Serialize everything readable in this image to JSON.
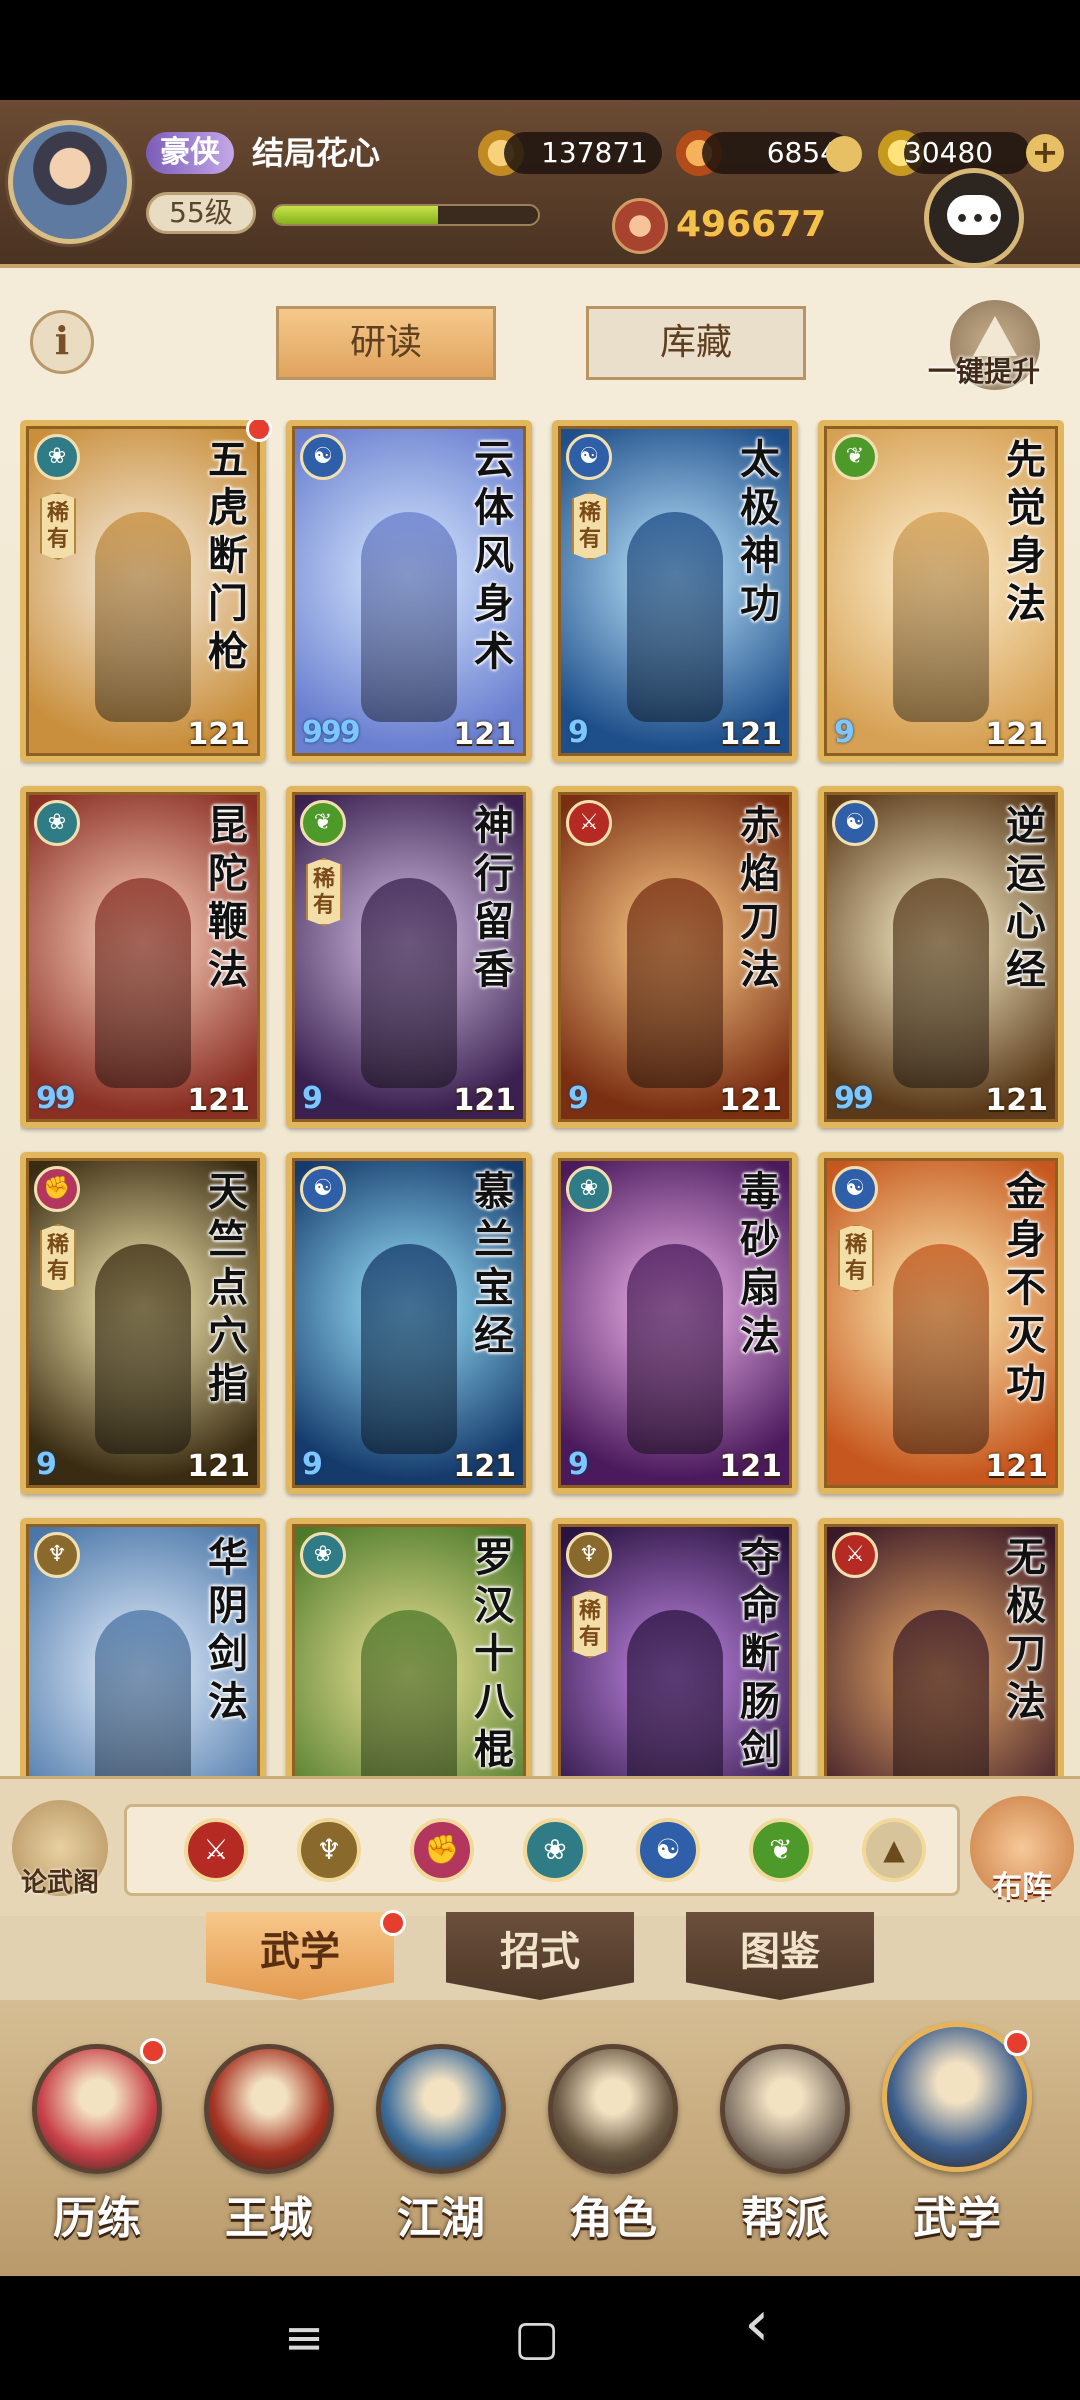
{
  "header": {
    "rank_badge": "豪侠",
    "player_name": "结局花心",
    "level": "55级",
    "exp_fraction": 0.62,
    "copper": "137871",
    "jade": "6854",
    "gold": "30480",
    "power": "496677",
    "icons": {
      "avatar": "avatar",
      "copper": "copper-coin-icon",
      "jade": "spirit-jade-icon",
      "gold": "gold-ingot-icon",
      "add": "plus-icon",
      "chat": "chat-icon",
      "power": "combat-power-icon"
    }
  },
  "top_tabs": {
    "info": "i",
    "study": "研读",
    "library": "库藏",
    "upgrade": "一键提升"
  },
  "cards": [
    {
      "title": "五虎断门枪",
      "level": "121",
      "rare": "稀有",
      "pips": "",
      "school": "lotus",
      "notify": true,
      "bg": [
        "#f7efe2",
        "#c98f3d"
      ]
    },
    {
      "title": "云体风身术",
      "level": "121",
      "rare": "",
      "pips": "999",
      "school": "taiji",
      "notify": false,
      "bg": [
        "#d9ebff",
        "#6a7fd0"
      ]
    },
    {
      "title": "太极神功",
      "level": "121",
      "rare": "稀有",
      "pips": "9",
      "school": "taiji",
      "notify": false,
      "bg": [
        "#bfe8ff",
        "#1f4f8a"
      ]
    },
    {
      "title": "先觉身法",
      "level": "121",
      "rare": "",
      "pips": "9",
      "school": "leaf",
      "notify": false,
      "bg": [
        "#fff1d2",
        "#d6a154"
      ]
    },
    {
      "title": "昆陀鞭法",
      "level": "121",
      "rare": "",
      "pips": "99",
      "school": "lotus",
      "notify": false,
      "bg": [
        "#ffd7c2",
        "#8a2f24"
      ]
    },
    {
      "title": "神行留香",
      "level": "121",
      "rare": "稀有",
      "pips": "9",
      "school": "leaf",
      "notify": false,
      "bg": [
        "#d7c3e8",
        "#3b2150"
      ]
    },
    {
      "title": "赤焰刀法",
      "level": "121",
      "rare": "",
      "pips": "9",
      "school": "blade",
      "notify": false,
      "bg": [
        "#ffcf8a",
        "#7a2f13"
      ]
    },
    {
      "title": "逆运心经",
      "level": "121",
      "rare": "",
      "pips": "99",
      "school": "taiji",
      "notify": false,
      "bg": [
        "#fff6cf",
        "#5a3a1a"
      ]
    },
    {
      "title": "天竺点穴指",
      "level": "121",
      "rare": "稀有",
      "pips": "9",
      "school": "fist",
      "notify": false,
      "bg": [
        "#fff3b8",
        "#3a2c12"
      ]
    },
    {
      "title": "慕兰宝经",
      "level": "121",
      "rare": "",
      "pips": "9",
      "school": "taiji",
      "notify": false,
      "bg": [
        "#9ee7ff",
        "#153b6c"
      ]
    },
    {
      "title": "毒砂扇法",
      "level": "121",
      "rare": "",
      "pips": "9",
      "school": "lotus",
      "notify": false,
      "bg": [
        "#f4b8f0",
        "#4a1a5c"
      ]
    },
    {
      "title": "金身不灭功",
      "level": "121",
      "rare": "稀有",
      "pips": "",
      "school": "taiji",
      "notify": false,
      "bg": [
        "#fff2b8",
        "#c6581f"
      ]
    },
    {
      "title": "华阴剑法",
      "level": "",
      "rare": "",
      "pips": "",
      "school": "sword",
      "notify": false,
      "bg": [
        "#eaf3ff",
        "#4a76a8"
      ]
    },
    {
      "title": "罗汉十八棍",
      "level": "",
      "rare": "",
      "pips": "",
      "school": "lotus",
      "notify": false,
      "bg": [
        "#f2e59a",
        "#4d7a2a"
      ]
    },
    {
      "title": "夺命断肠剑",
      "level": "",
      "rare": "稀有",
      "pips": "",
      "school": "sword",
      "notify": false,
      "bg": [
        "#c48ae8",
        "#2a1340"
      ]
    },
    {
      "title": "无极刀法",
      "level": "",
      "rare": "",
      "pips": "",
      "school": "blade",
      "notify": false,
      "bg": [
        "#f0b06a",
        "#3b1a28"
      ]
    }
  ],
  "filter_bar": {
    "left_label": "论武阁",
    "right_label": "布阵",
    "schools": [
      {
        "icon": "blade-school-icon",
        "glyph": "⚔",
        "color": "#b52a22"
      },
      {
        "icon": "sword-school-icon",
        "glyph": "♆",
        "color": "#8a6a2c"
      },
      {
        "icon": "fist-school-icon",
        "glyph": "✊",
        "color": "#b3365f"
      },
      {
        "icon": "lotus-school-icon",
        "glyph": "❀",
        "color": "#2f7c86"
      },
      {
        "icon": "taiji-school-icon",
        "glyph": "☯",
        "color": "#2f5fa8"
      },
      {
        "icon": "leaf-school-icon",
        "glyph": "❦",
        "color": "#4d9a2a"
      },
      {
        "icon": "all-schools-icon",
        "glyph": "▲",
        "color": "#d8c49a"
      }
    ]
  },
  "sub_tabs": {
    "wuxue": "武学",
    "zhaoshi": "招式",
    "tujian": "图鉴"
  },
  "nav": [
    {
      "label": "历练",
      "icon": "training-icon",
      "color": "#c9424a",
      "notify": true
    },
    {
      "label": "王城",
      "icon": "royal-city-icon",
      "color": "#a63322",
      "notify": false
    },
    {
      "label": "江湖",
      "icon": "jianghu-icon",
      "color": "#3b6c9a",
      "notify": false
    },
    {
      "label": "角色",
      "icon": "character-icon",
      "color": "#6b5a44",
      "notify": false
    },
    {
      "label": "帮派",
      "icon": "guild-icon",
      "color": "#8a7d6e",
      "notify": false
    },
    {
      "label": "武学",
      "icon": "martial-arts-icon",
      "color": "#3d5e8c",
      "notify": true
    }
  ],
  "system_nav": {
    "recent": "≡",
    "home": "▢",
    "back": "‹"
  },
  "school_colors": {
    "lotus": "#2f7c86",
    "taiji": "#2f5fa8",
    "leaf": "#4d9a2a",
    "blade": "#b52a22",
    "fist": "#b3365f",
    "sword": "#8a6a2c"
  },
  "school_glyphs": {
    "lotus": "❀",
    "taiji": "☯",
    "leaf": "❦",
    "blade": "⚔",
    "fist": "✊",
    "sword": "♆"
  }
}
